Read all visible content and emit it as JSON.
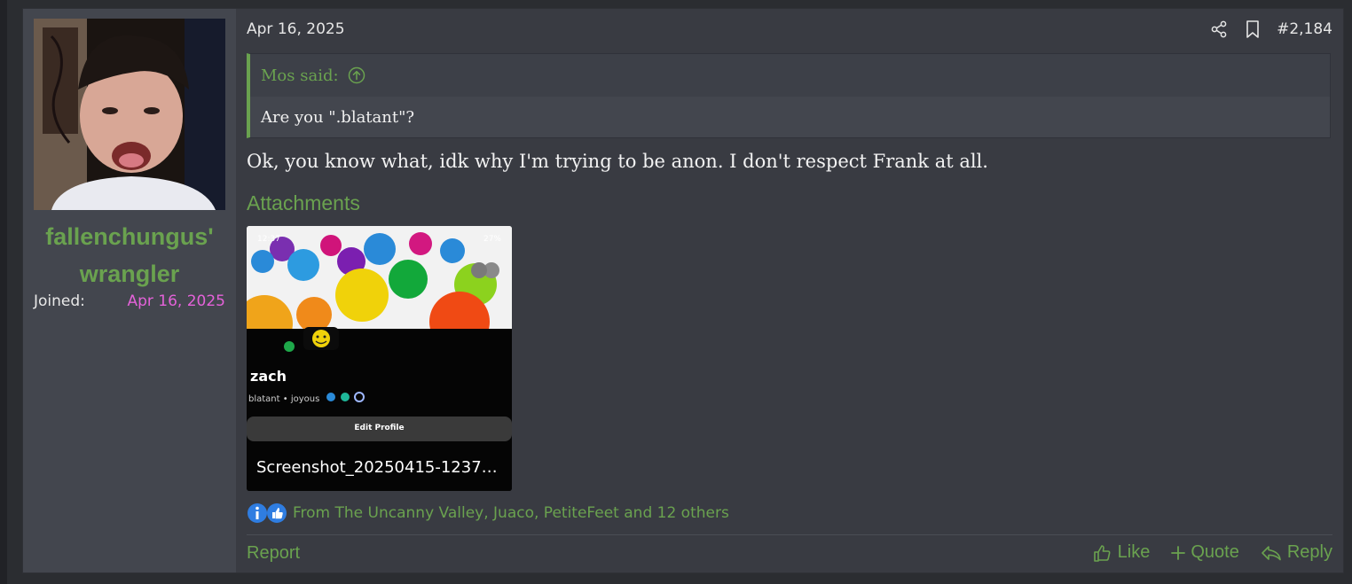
{
  "user": {
    "name": "fallenchungus' wrangler",
    "joined_label": "Joined:",
    "joined_date": "Apr 16, 2025"
  },
  "post": {
    "date": "Apr 16, 2025",
    "number": "#2,184",
    "quote": {
      "author_line": "Mos said:",
      "text": "Are you \".blatant\"?"
    },
    "message": "Ok, you know what, idk why I'm trying to be anon. I don't respect Frank at all.",
    "attachments_title": "Attachments",
    "attachment": {
      "filename": "Screenshot_20250415-12372...",
      "status_time": "12:37",
      "battery": "27%",
      "profile_name": "zach",
      "profile_tags": "blatant • joyous",
      "edit_profile_label": "Edit Profile"
    },
    "reactions_text": "From The Uncanny Valley, Juaco, PetiteFeet and 12 others",
    "footer": {
      "report": "Report",
      "like": "Like",
      "quote": "Quote",
      "reply": "Reply"
    }
  },
  "colors": {
    "accent_green": "#6aa24f",
    "date_pink": "#e462d9",
    "panel": "#393b42",
    "sidebar": "#43464e"
  },
  "icons": {
    "share": "share-icon",
    "bookmark": "bookmark-icon",
    "quote_up": "arrow-up-circle-icon",
    "reaction_info": "info-reaction-icon",
    "reaction_like": "thumbs-up-reaction-icon",
    "like": "thumbs-up-icon",
    "quote": "plus-icon",
    "reply": "reply-icon"
  }
}
